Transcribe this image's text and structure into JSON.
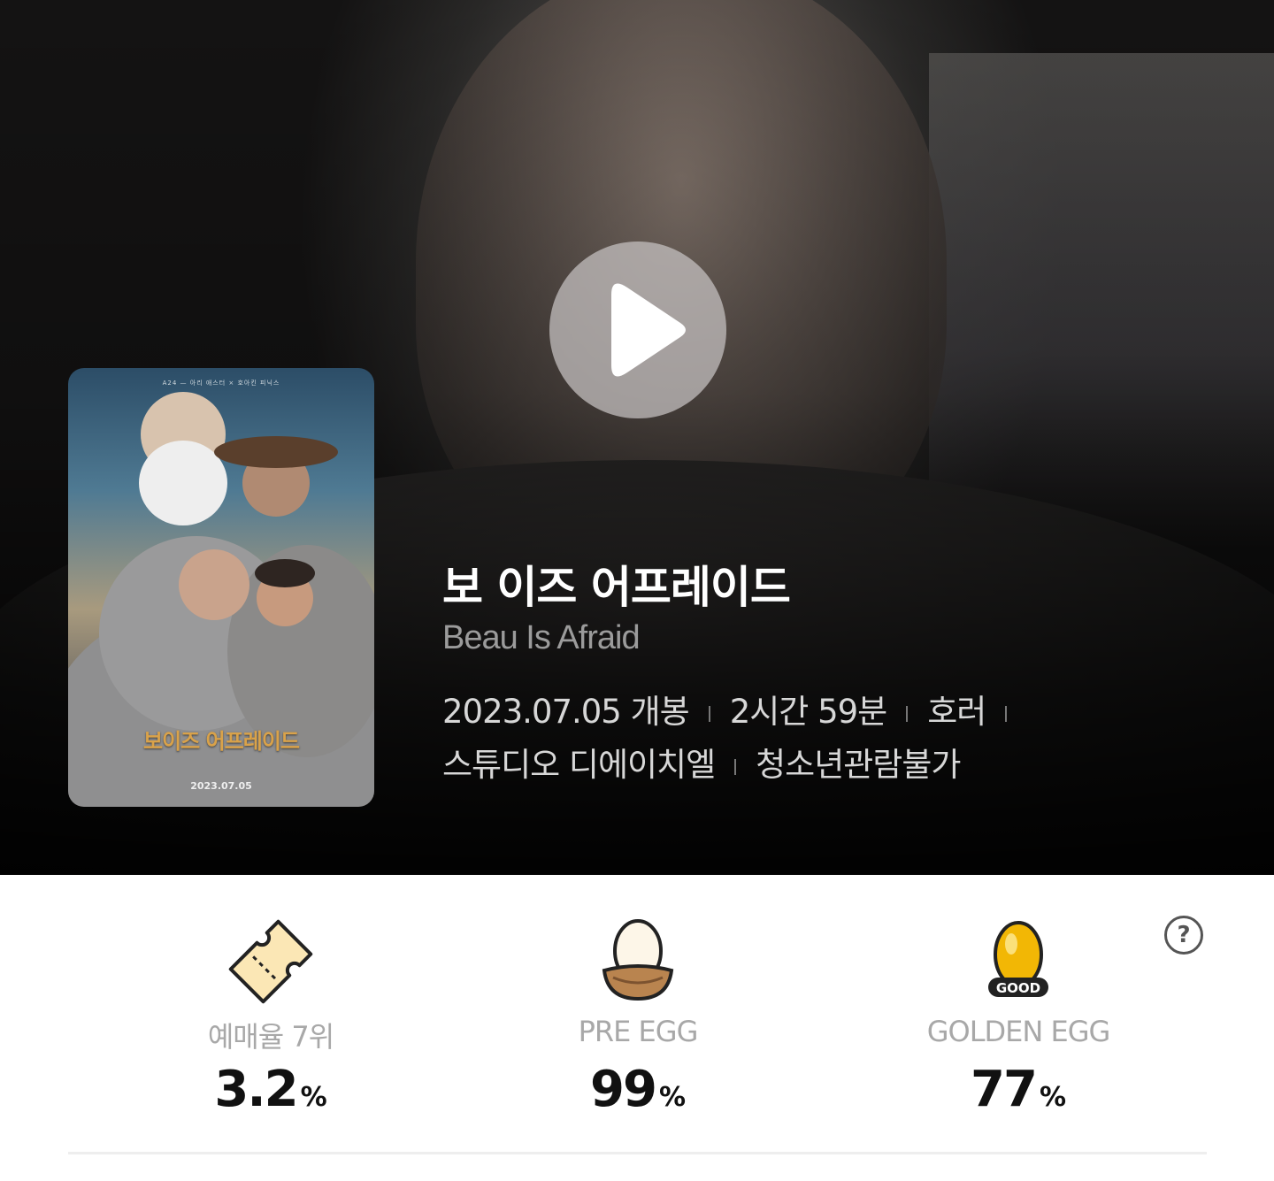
{
  "movie": {
    "title_ko": "보 이즈 어프레이드",
    "title_en": "Beau Is Afraid",
    "release": "2023.07.05 개봉",
    "runtime": "2시간 59분",
    "genre": "호러",
    "distributor": "스튜디오 디에이치엘",
    "rating": "청소년관람불가"
  },
  "poster": {
    "top_text": "A24  —  아리 애스터 × 호아킨 피닉스",
    "title": "보이즈 어프레이드",
    "date": "2023.07.05"
  },
  "stats": [
    {
      "label": "예매율 7위",
      "value": "3.2",
      "unit": "%",
      "icon": "ticket-icon"
    },
    {
      "label": "PRE EGG",
      "value": "99",
      "unit": "%",
      "icon": "egg-nest-icon"
    },
    {
      "label": "GOLDEN EGG",
      "value": "77",
      "unit": "%",
      "icon": "golden-egg-icon",
      "badge": "GOOD"
    }
  ],
  "help": {
    "label": "?"
  },
  "colors": {
    "accent_gold": "#f2b705",
    "label_gray": "#a8a8a8",
    "title_white": "#ffffff"
  }
}
